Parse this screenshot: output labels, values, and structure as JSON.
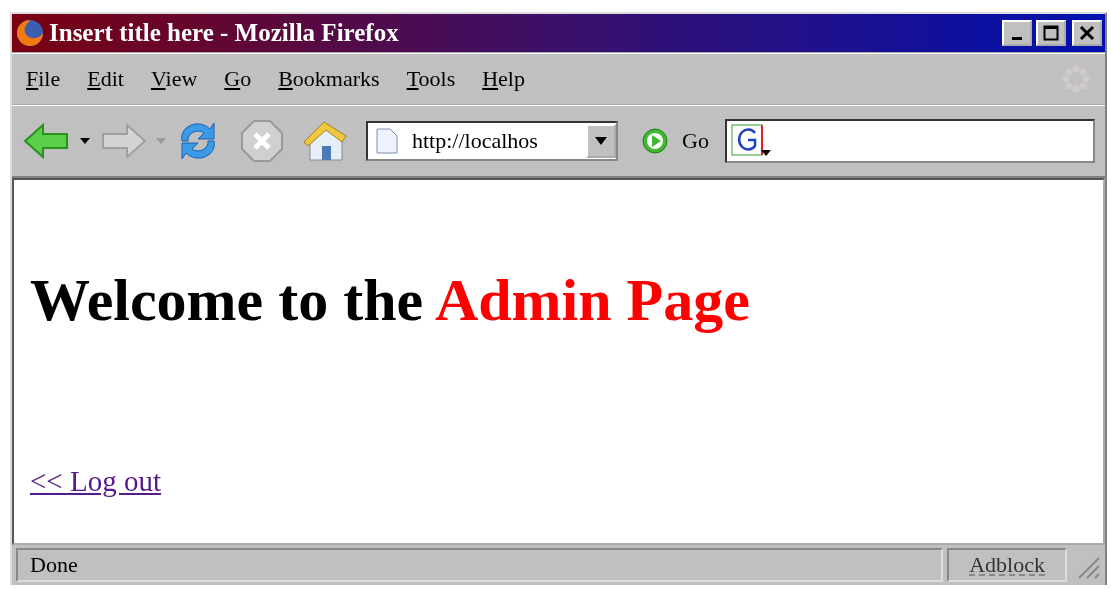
{
  "window": {
    "title": "Insert title here - Mozilla Firefox"
  },
  "menu": [
    {
      "label": "File"
    },
    {
      "label": "Edit"
    },
    {
      "label": "View"
    },
    {
      "label": "Go"
    },
    {
      "label": "Bookmarks"
    },
    {
      "label": "Tools"
    },
    {
      "label": "Help"
    }
  ],
  "toolbar": {
    "back_disabled": false,
    "forward_disabled": true,
    "address": "http://localhos",
    "go": "Go"
  },
  "page": {
    "heading": [
      {
        "text": "Welcome to the ",
        "emphasis": false
      },
      {
        "text": "Admin Page",
        "emphasis": true
      }
    ],
    "link": "<< Log out"
  },
  "status_bar": {
    "status": "Done",
    "addon": "Adblock"
  }
}
